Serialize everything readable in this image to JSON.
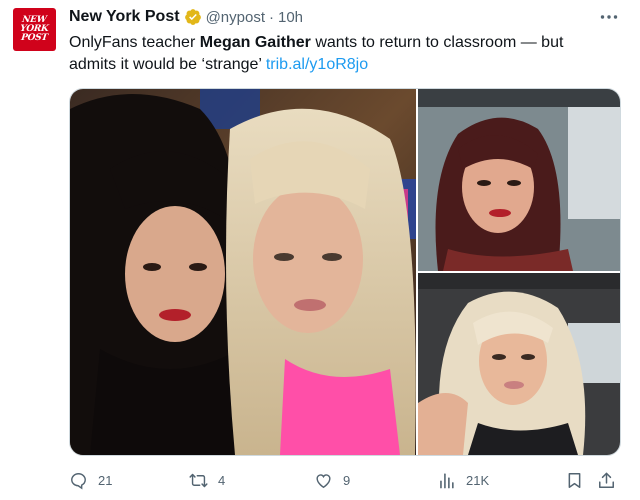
{
  "account": {
    "name": "New York Post",
    "handle": "@nypost",
    "separator": "·",
    "time": "10h",
    "avatar_lines": [
      "NEW",
      "YORK",
      "POST"
    ],
    "brand_color": "#d0021b",
    "verified_color": "#e2b719"
  },
  "tweet": {
    "text_before": "OnlyFans teacher ",
    "text_bold": "Megan Gaither",
    "text_after": " wants to return to classroom — but admits it would be ‘strange’ ",
    "link": "trib.al/y1oR8jo",
    "link_color": "#1d9bf0"
  },
  "media": {
    "photos": [
      {
        "name": "selfie-two-women"
      },
      {
        "name": "selfie-dark-hair-car"
      },
      {
        "name": "selfie-blonde-car"
      }
    ]
  },
  "actions": {
    "reply": {
      "icon": "reply-icon",
      "count": "21"
    },
    "retweet": {
      "icon": "retweet-icon",
      "count": "4"
    },
    "like": {
      "icon": "heart-icon",
      "count": "9"
    },
    "views": {
      "icon": "views-icon",
      "count": "21K"
    },
    "bookmark": {
      "icon": "bookmark-icon"
    },
    "share": {
      "icon": "share-icon"
    }
  },
  "more_icon": "more-icon"
}
